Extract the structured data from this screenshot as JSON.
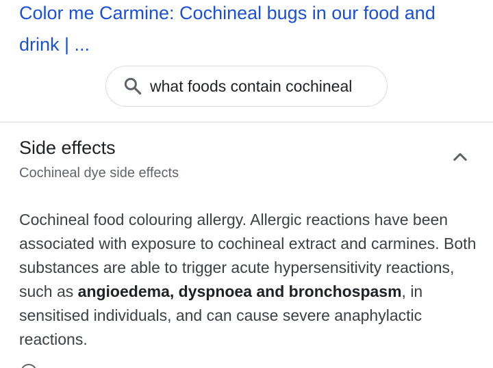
{
  "result": {
    "title": "Color me Carmine: Cochineal bugs in our food and drink | ..."
  },
  "related_search": {
    "icon": "search-icon",
    "query": "what foods contain cochineal"
  },
  "section": {
    "title": "Side effects",
    "subtitle": "Cochineal dye side effects",
    "expanded": true,
    "toggle_icon": "chevron-up-icon"
  },
  "snippet": {
    "text_1": "Cochineal food colouring allergy. Allergic reactions have been associated with exposure to cochineal extract and carmines. Both substances are able to trigger acute hypersensitivity reactions, such as ",
    "bold": "angioedema, dyspnoea and bronchospasm",
    "text_2": ", in sensitised individuals, and can cause severe anaphylactic reactions."
  },
  "colors": {
    "link": "#1a4fd6",
    "body_text": "#3c4043",
    "secondary_text": "#5f6368",
    "divider": "#dadce0"
  }
}
